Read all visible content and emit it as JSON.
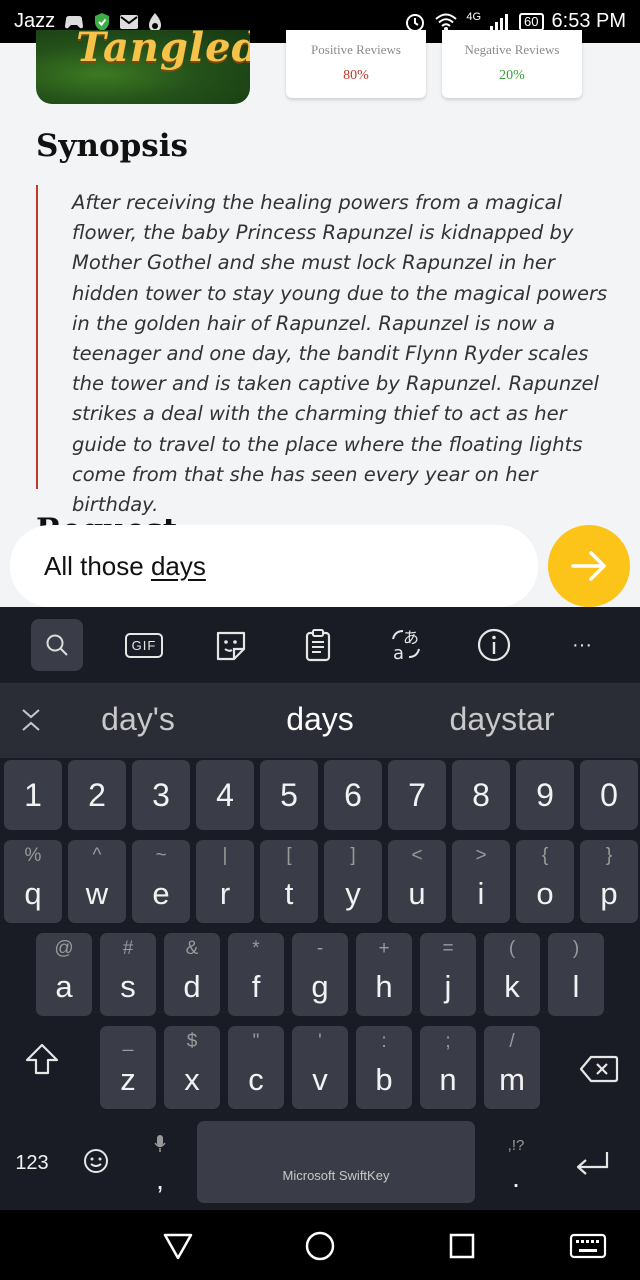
{
  "status_bar": {
    "carrier": "Jazz",
    "network": "4G",
    "battery": "60",
    "time": "6:53 PM"
  },
  "movie": {
    "poster_title": "Tangled",
    "positive_reviews": {
      "label": "Positive Reviews",
      "value": "80%"
    },
    "negative_reviews": {
      "label": "Negative Reviews",
      "value": "20%"
    },
    "synopsis_heading": "Synopsis",
    "synopsis_text": "After receiving the healing powers from a magical flower, the baby Princess Rapunzel is kidnapped by Mother Gothel and she must lock Rapunzel in her hidden tower to stay young due to the magical powers in the golden hair of Rapunzel. Rapunzel is now a teenager and one day, the bandit Flynn Ryder scales the tower and is taken captive by Rapunzel. Rapunzel strikes a deal with the charming thief to act as her guide to travel to the place where the floating lights come from that she has seen every year on her birthday.",
    "next_heading": "Request"
  },
  "reply": {
    "text_prefix": "All those ",
    "text_current_word": "days"
  },
  "keyboard": {
    "toolbar": {
      "gif_label": "GIF",
      "more_label": "···"
    },
    "suggestions": [
      "day's",
      "days",
      "daystar"
    ],
    "number_row": [
      "1",
      "2",
      "3",
      "4",
      "5",
      "6",
      "7",
      "8",
      "9",
      "0"
    ],
    "row_q": [
      {
        "main": "q",
        "sub": "%"
      },
      {
        "main": "w",
        "sub": "^"
      },
      {
        "main": "e",
        "sub": "~"
      },
      {
        "main": "r",
        "sub": "|"
      },
      {
        "main": "t",
        "sub": "["
      },
      {
        "main": "y",
        "sub": "]"
      },
      {
        "main": "u",
        "sub": "<"
      },
      {
        "main": "i",
        "sub": ">"
      },
      {
        "main": "o",
        "sub": "{"
      },
      {
        "main": "p",
        "sub": "}"
      }
    ],
    "row_a": [
      {
        "main": "a",
        "sub": "@"
      },
      {
        "main": "s",
        "sub": "#"
      },
      {
        "main": "d",
        "sub": "&"
      },
      {
        "main": "f",
        "sub": "*"
      },
      {
        "main": "g",
        "sub": "-"
      },
      {
        "main": "h",
        "sub": "+"
      },
      {
        "main": "j",
        "sub": "="
      },
      {
        "main": "k",
        "sub": "("
      },
      {
        "main": "l",
        "sub": ")"
      }
    ],
    "row_z": [
      {
        "main": "z",
        "sub": "_"
      },
      {
        "main": "x",
        "sub": "$"
      },
      {
        "main": "c",
        "sub": "\""
      },
      {
        "main": "v",
        "sub": "'"
      },
      {
        "main": "b",
        "sub": ":"
      },
      {
        "main": "n",
        "sub": ";"
      },
      {
        "main": "m",
        "sub": "/"
      }
    ],
    "numbers_key": "123",
    "comma_key": ",",
    "space_label": "Microsoft SwiftKey",
    "punct_key_sub": ",!?",
    "punct_key_main": "."
  }
}
